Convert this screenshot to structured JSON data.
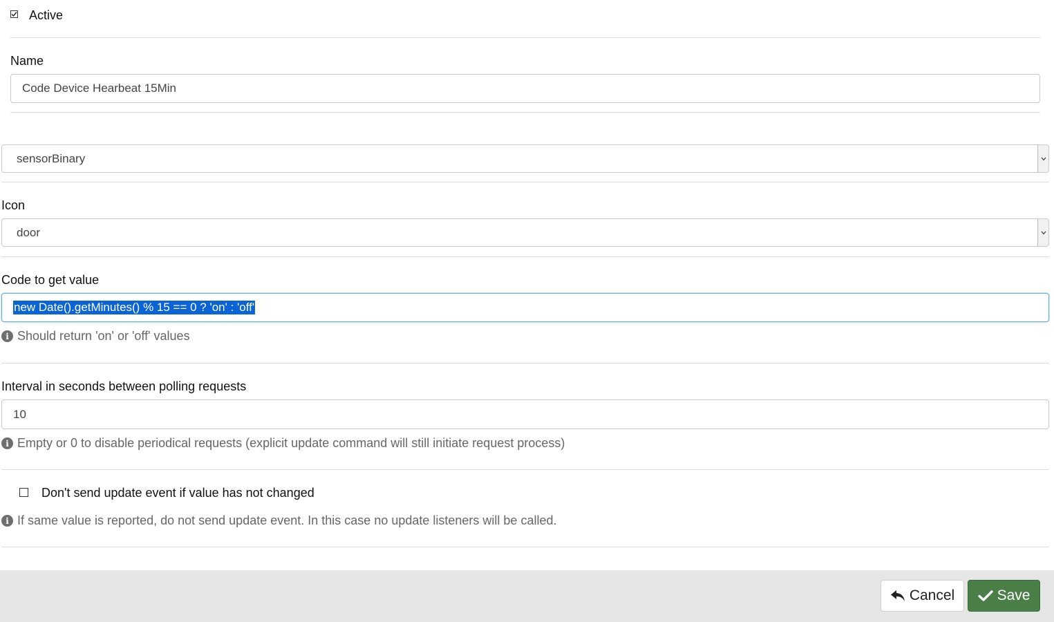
{
  "active": {
    "label": "Active",
    "checked": true
  },
  "name": {
    "label": "Name",
    "value": "Code Device Hearbeat 15Min"
  },
  "device_type": {
    "value": "sensorBinary"
  },
  "icon": {
    "label": "Icon",
    "value": "door"
  },
  "code": {
    "label": "Code to get value",
    "value": "new Date().getMinutes() % 15 == 0 ? 'on' : 'off'",
    "help": "Should return 'on' or 'off' values"
  },
  "interval": {
    "label": "Interval in seconds between polling requests",
    "value": "10",
    "help": "Empty or 0 to disable periodical requests (explicit update command will still initiate request process)"
  },
  "skip_event": {
    "label": "Don't send update event if value has not changed",
    "checked": false,
    "help": "If same value is reported, do not send update event. In this case no update listeners will be called."
  },
  "footer": {
    "cancel_label": "Cancel",
    "save_label": "Save"
  },
  "icons": {
    "info": "info-icon",
    "check": "check-icon",
    "undo": "undo-arrow-icon",
    "chevron": "chevron-down-icon"
  },
  "colors": {
    "save_bg": "#4a7f48",
    "selection": "#0a64d6",
    "focus_border": "#66afe9"
  }
}
